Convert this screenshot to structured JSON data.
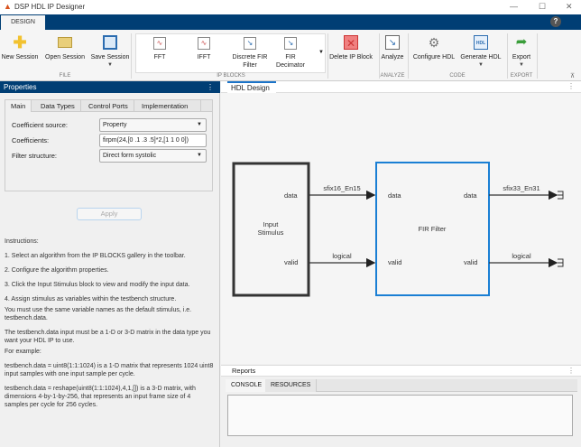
{
  "window": {
    "title": "DSP HDL IP Designer",
    "minimize_icon": "minimize-icon",
    "maximize_icon": "maximize-icon",
    "close_icon": "close-icon"
  },
  "ribbon": {
    "tab": "DESIGN",
    "help": "?",
    "file": {
      "label": "FILE",
      "new": "New Session",
      "open": "Open Session",
      "save": "Save Session"
    },
    "ip_blocks": {
      "label": "IP BLOCKS",
      "items": [
        "FFT",
        "IFFT",
        "Discrete FIR Filter",
        "FIR Decimator"
      ]
    },
    "delete": "Delete IP Block",
    "analyze": {
      "label": "ANALYZE",
      "button": "Analyze"
    },
    "code": {
      "label": "CODE",
      "configure": "Configure HDL",
      "generate": "Generate HDL"
    },
    "export": {
      "label": "EXPORT",
      "button": "Export"
    }
  },
  "properties": {
    "title": "Properties",
    "tabs": [
      "Main",
      "Data Types",
      "Control Ports",
      "Implementation"
    ],
    "coefficient_source_label": "Coefficient source:",
    "coefficient_source_value": "Property",
    "coefficients_label": "Coefficients:",
    "coefficients_value": "firpm(24,[0 .1 .3 .5]*2,[1 1 0 0])",
    "filter_structure_label": "Filter structure:",
    "filter_structure_value": "Direct form systolic",
    "apply": "Apply"
  },
  "instructions": [
    "Instructions:",
    "1. Select an algorithm from the IP BLOCKS gallery in the toolbar.",
    "2. Configure the algorithm properties.",
    "3. Click the Input Stimulus block to view and modify the input data.",
    "4. Assign stimulus as variables within the testbench structure.",
    "You must use the same variable names as the default stimulus, i.e. testbench.data.",
    "The testbench.data input must be a 1-D or 3-D matrix in the data type you want your HDL IP to use.",
    "For example:",
    "testbench.data = uint8(1:1:1024) is a 1-D matrix that represents 1024 uint8 input samples with one input sample per cycle.",
    "testbench.data = reshape(uint8(1:1:1024),4,1,[]) is a 3-D matrix, with dimensions 4-by-1-by-256, that represents an input frame size of 4 samples per cycle for 256 cycles."
  ],
  "design": {
    "tab": "HDL Design",
    "input_block": "Input Stimulus",
    "filter_block": "FIR Filter",
    "port_data": "data",
    "port_valid": "valid",
    "in_data_type": "sfix16_En15",
    "in_valid_type": "logical",
    "out_data_type": "sfix33_En31",
    "out_valid_type": "logical",
    "filter_border_color": "#1a7fd4"
  },
  "reports": {
    "title": "Reports",
    "tabs": [
      "CONSOLE",
      "RESOURCES"
    ],
    "console_text": ""
  }
}
